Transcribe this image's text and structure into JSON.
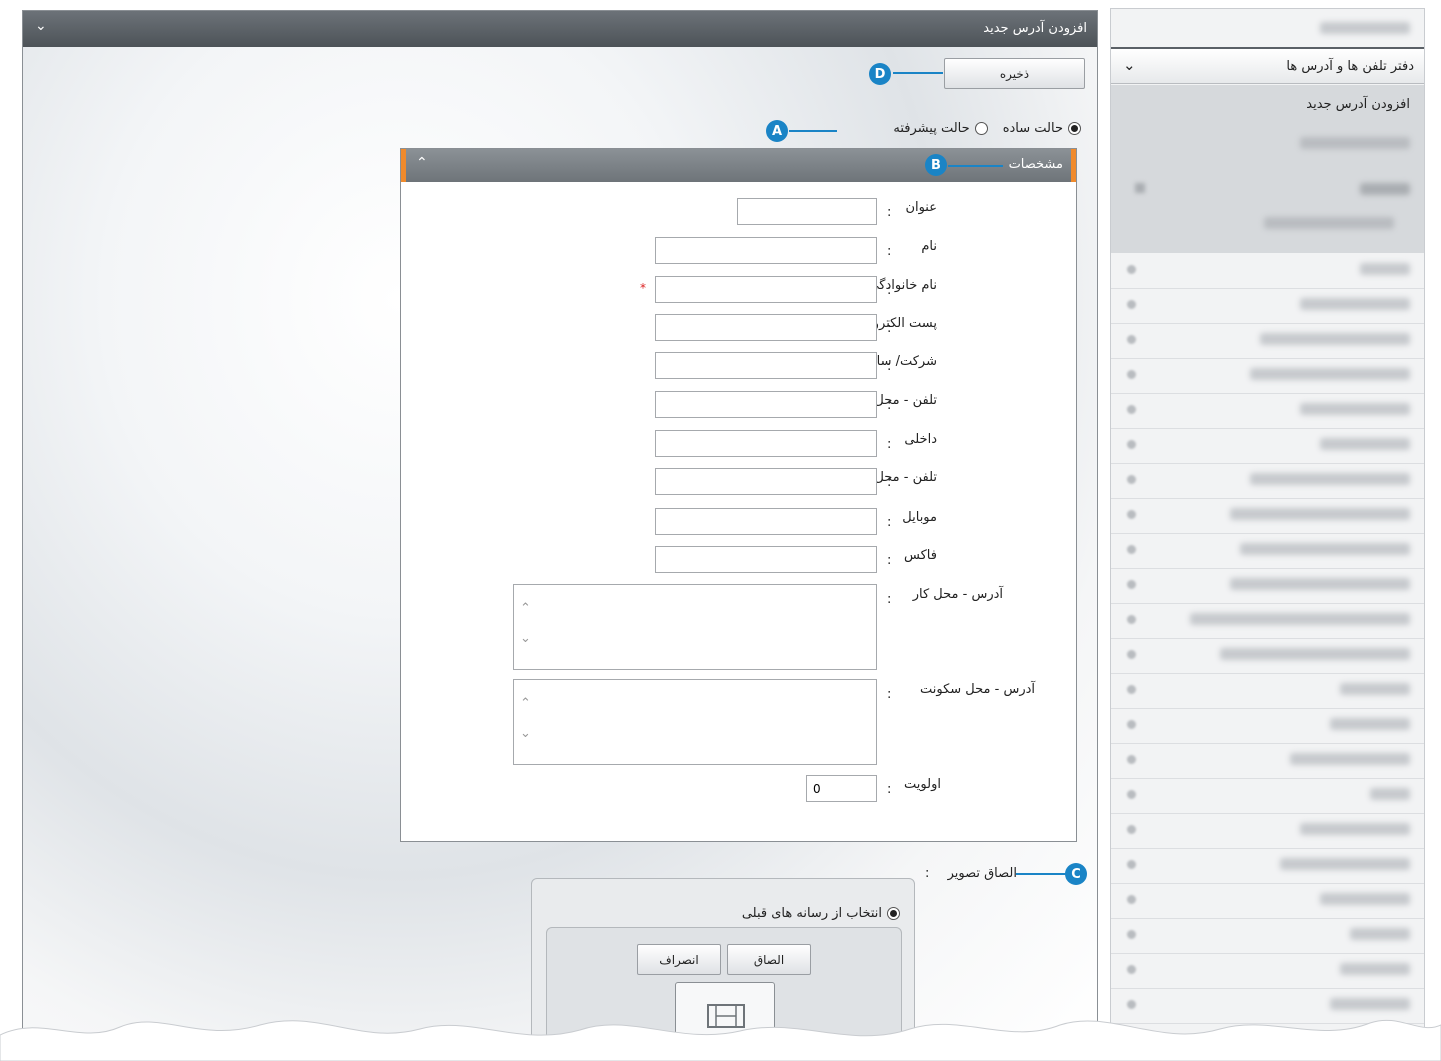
{
  "main": {
    "title": "افزودن آدرس جدید",
    "save_label": "ذخیره",
    "mode": {
      "simple_label": "حالت ساده",
      "advanced_label": "حالت پیشرفته",
      "selected": "simple"
    },
    "details": {
      "title": "مشخصات",
      "fields": [
        {
          "label": "عنوان",
          "value": ""
        },
        {
          "label": "نام",
          "value": ""
        },
        {
          "label": "نام خانوادگی",
          "value": "",
          "required_mark": "*"
        },
        {
          "label": "پست الکترونیک",
          "value": ""
        },
        {
          "label": "شرکت/ سازمان",
          "value": ""
        },
        {
          "label": "تلفن - محل کار",
          "value": ""
        },
        {
          "label": "داخلی",
          "value": ""
        },
        {
          "label": "تلفن - محل سکونت",
          "value": ""
        },
        {
          "label": "موبایل",
          "value": ""
        },
        {
          "label": "فاکس",
          "value": ""
        },
        {
          "label": "آدرس - محل کار",
          "value": ""
        },
        {
          "label": "آدرس - محل سکونت",
          "value": ""
        },
        {
          "label": "اولویت",
          "value": "0"
        }
      ],
      "colon": ":"
    },
    "attach": {
      "label": "الصاق تصویر",
      "colon": ":",
      "radio_label": "انتخاب از رسانه های قبلی",
      "attach_button": "الصاق",
      "cancel_button": "انصراف"
    }
  },
  "callouts": {
    "a": "A",
    "b": "B",
    "c": "C",
    "d": "D"
  },
  "sidebar": {
    "section_title": "دفتر تلفن ها و آدرس ها",
    "selected_item": "افزودن آدرس جدید"
  },
  "colors": {
    "callout": "#1a84c6",
    "header_dark": "#4d5358",
    "section_accent": "#f08a2c"
  }
}
